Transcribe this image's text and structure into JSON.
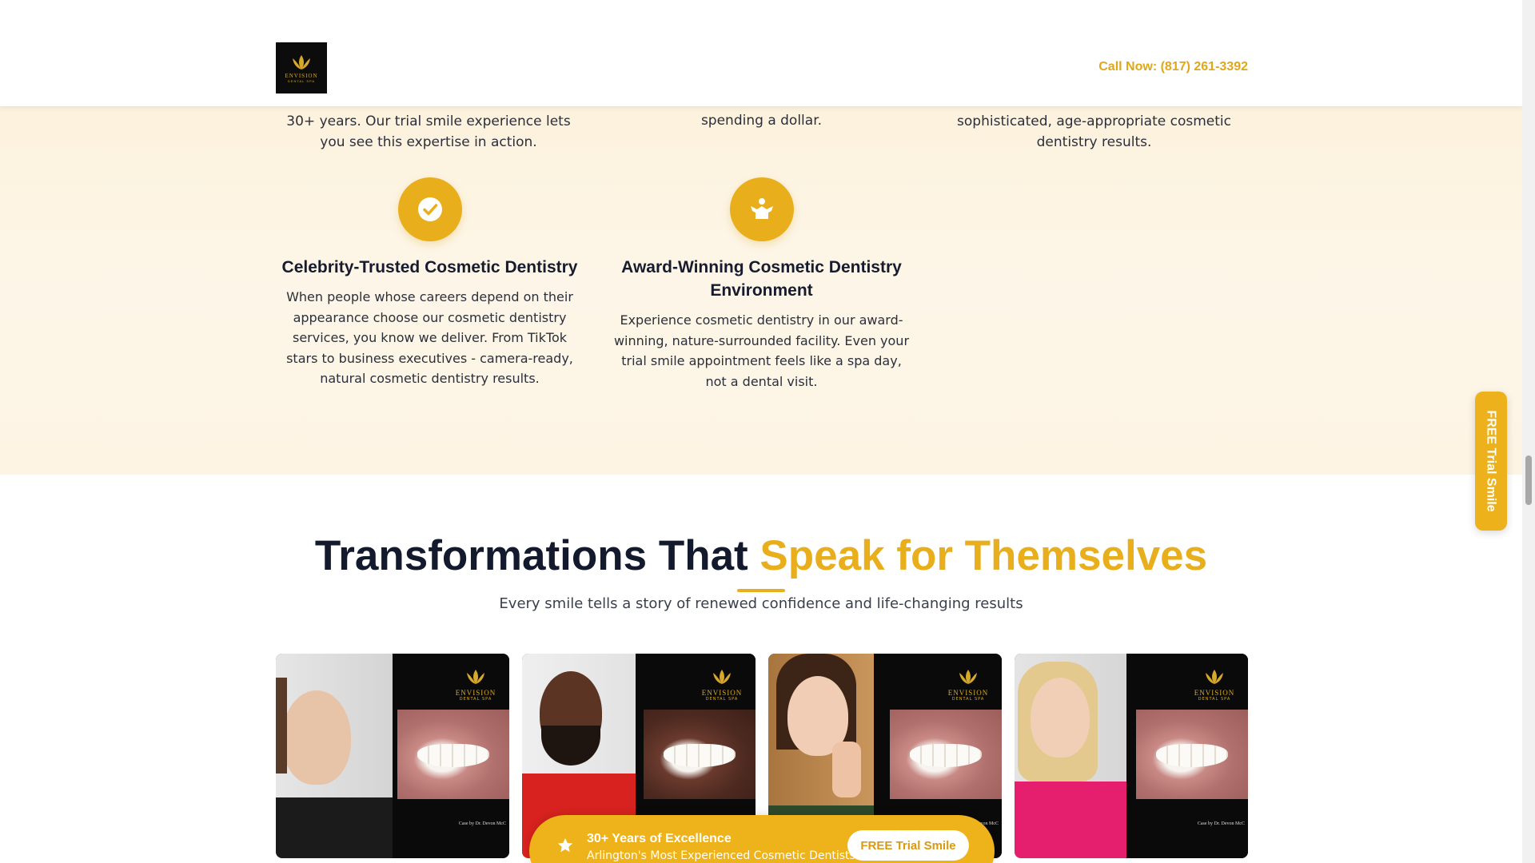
{
  "header": {
    "logo_word": "ENVISION",
    "logo_sub": "DENTAL SPA",
    "call_label": "Call Now: (817) 261-3392"
  },
  "features": {
    "partial_texts": [
      "30+ years. Our trial smile experience lets you see this expertise in action.",
      "spending a dollar.",
      "sophisticated, age-appropriate cosmetic dentistry results."
    ],
    "items": [
      {
        "icon": "check-circle-icon",
        "title": "Celebrity-Trusted Cosmetic Dentistry",
        "body": "When people whose careers depend on their appearance choose our cosmetic dentistry services, you know we deliver. From TikTok stars to business executives - camera-ready, natural cosmetic dentistry results."
      },
      {
        "icon": "spa-person-icon",
        "title": "Award-Winning Cosmetic Dentistry Environment",
        "body": "Experience cosmetic dentistry in our award-winning, nature-surrounded facility. Even your trial smile appointment feels like a spa day, not a dental visit."
      }
    ]
  },
  "side_tab": {
    "label": "FREE Trial Smile"
  },
  "transformations": {
    "title_main": "Transformations That ",
    "title_accent": "Speak for Themselves",
    "subtitle": "Every smile tells a story of renewed confidence and life-changing results",
    "card_brand": "ENVISION",
    "card_brand_sub": "DENTAL SPA",
    "card_credit": "Case by Dr. Devon McC"
  },
  "promo": {
    "title": "30+ Years of Excellence",
    "subtitle": "Arlington's Most Experienced Cosmetic Dentists",
    "button_label": "FREE Trial Smile"
  },
  "colors": {
    "accent": "#e8ae1c",
    "dark": "#141a2e"
  }
}
